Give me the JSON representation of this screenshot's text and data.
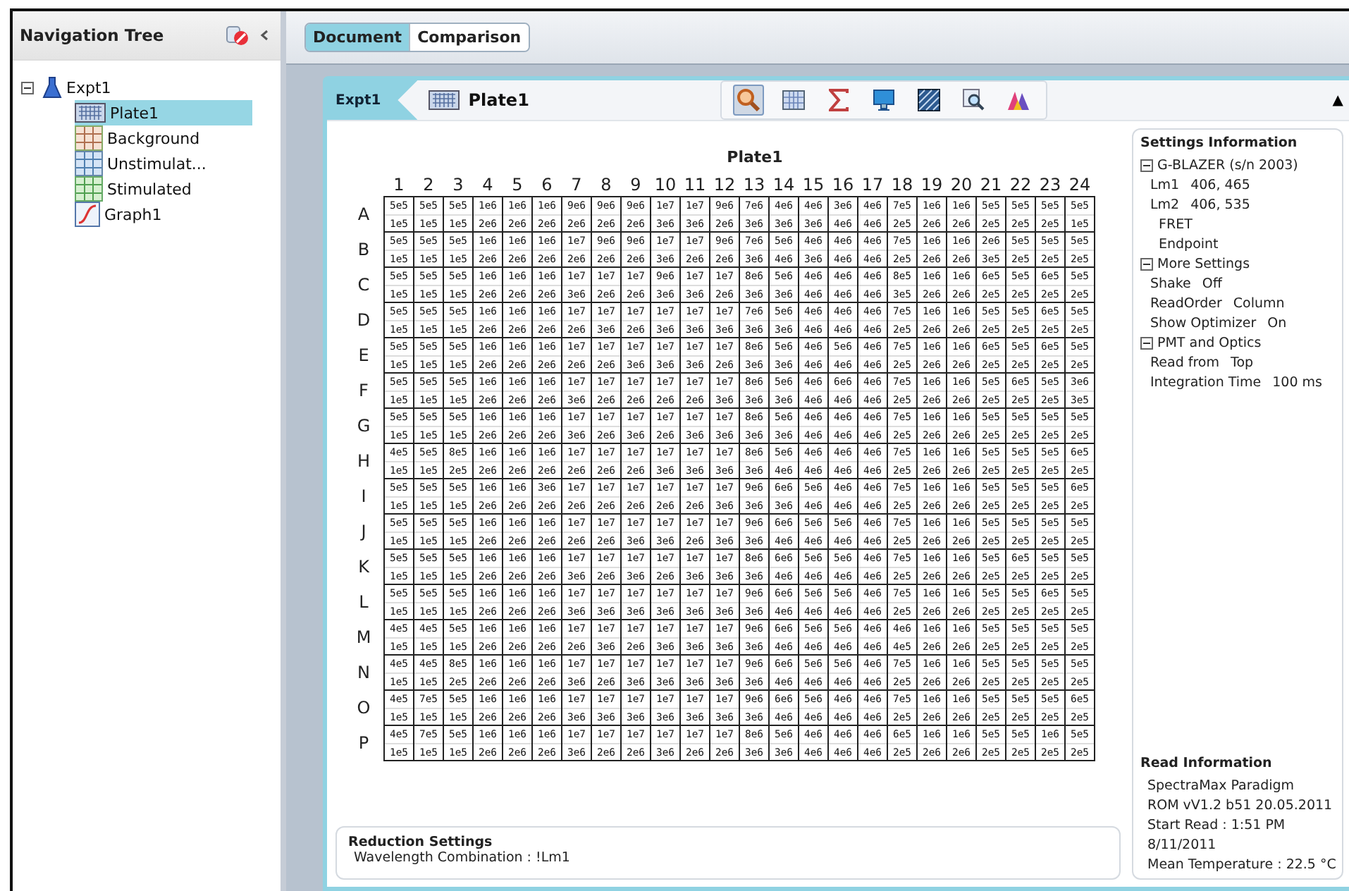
{
  "navigation": {
    "title": "Navigation Tree",
    "tree": [
      {
        "label": "Expt1",
        "kind": "experiment",
        "expanded": true,
        "selected": false,
        "children": [
          {
            "label": "Plate1",
            "kind": "plate",
            "selected": true
          },
          {
            "label": "Background",
            "kind": "background",
            "selected": false
          },
          {
            "label": "Unstimulat...",
            "kind": "unstimulated",
            "selected": false
          },
          {
            "label": "Stimulated",
            "kind": "stimulated",
            "selected": false
          },
          {
            "label": "Graph1",
            "kind": "graph",
            "selected": false
          }
        ]
      }
    ]
  },
  "tabs": [
    {
      "label": "Document",
      "selected": true
    },
    {
      "label": "Comparison",
      "selected": false
    }
  ],
  "document": {
    "breadcrumb": {
      "parent": "Expt1",
      "current": "Plate1"
    },
    "toolbar": [
      {
        "kind": "zoom",
        "selected": true
      },
      {
        "kind": "grid",
        "selected": false
      },
      {
        "kind": "sigma",
        "selected": false
      },
      {
        "kind": "monitor",
        "selected": false
      },
      {
        "kind": "pattern",
        "selected": false
      },
      {
        "kind": "search",
        "selected": false
      },
      {
        "kind": "peaks",
        "selected": false
      }
    ],
    "collapse_arrow": "▲",
    "plate": {
      "title": "Plate1",
      "columns": [
        "1",
        "2",
        "3",
        "4",
        "5",
        "6",
        "7",
        "8",
        "9",
        "10",
        "11",
        "12",
        "13",
        "14",
        "15",
        "16",
        "17",
        "18",
        "19",
        "20",
        "21",
        "22",
        "23",
        "24"
      ],
      "rows": [
        {
          "label": "A",
          "top": [
            "5e5",
            "5e5",
            "5e5",
            "1e6",
            "1e6",
            "1e6",
            "9e6",
            "9e6",
            "9e6",
            "1e7",
            "1e7",
            "9e6",
            "7e6",
            "4e6",
            "4e6",
            "3e6",
            "4e6",
            "7e5",
            "1e6",
            "1e6",
            "5e5",
            "5e5",
            "5e5",
            "5e5"
          ],
          "bottom": [
            "1e5",
            "1e5",
            "1e5",
            "2e6",
            "2e6",
            "2e6",
            "2e6",
            "2e6",
            "2e6",
            "3e6",
            "3e6",
            "2e6",
            "3e6",
            "3e6",
            "3e6",
            "4e6",
            "4e6",
            "2e5",
            "2e6",
            "2e6",
            "2e5",
            "2e5",
            "2e5",
            "1e5"
          ]
        },
        {
          "label": "B",
          "top": [
            "5e5",
            "5e5",
            "5e5",
            "1e6",
            "1e6",
            "1e6",
            "1e7",
            "9e6",
            "9e6",
            "1e7",
            "1e7",
            "9e6",
            "7e6",
            "5e6",
            "4e6",
            "4e6",
            "4e6",
            "7e5",
            "1e6",
            "1e6",
            "2e6",
            "5e5",
            "5e5",
            "5e5"
          ],
          "bottom": [
            "1e5",
            "1e5",
            "1e5",
            "2e6",
            "2e6",
            "2e6",
            "2e6",
            "2e6",
            "2e6",
            "3e6",
            "2e6",
            "2e6",
            "3e6",
            "4e6",
            "3e6",
            "4e6",
            "4e6",
            "2e5",
            "2e6",
            "2e6",
            "3e5",
            "2e5",
            "2e5",
            "2e5"
          ]
        },
        {
          "label": "C",
          "top": [
            "5e5",
            "5e5",
            "5e5",
            "1e6",
            "1e6",
            "1e6",
            "1e7",
            "1e7",
            "1e7",
            "9e6",
            "1e7",
            "1e7",
            "8e6",
            "5e6",
            "4e6",
            "4e6",
            "4e6",
            "8e5",
            "1e6",
            "1e6",
            "6e5",
            "5e5",
            "6e5",
            "5e5"
          ],
          "bottom": [
            "1e5",
            "1e5",
            "1e5",
            "2e6",
            "2e6",
            "2e6",
            "3e6",
            "2e6",
            "2e6",
            "3e6",
            "3e6",
            "2e6",
            "3e6",
            "3e6",
            "4e6",
            "4e6",
            "4e6",
            "3e5",
            "2e6",
            "2e6",
            "2e5",
            "2e5",
            "2e5",
            "2e5"
          ]
        },
        {
          "label": "D",
          "top": [
            "5e5",
            "5e5",
            "5e5",
            "1e6",
            "1e6",
            "1e6",
            "1e7",
            "1e7",
            "1e7",
            "1e7",
            "1e7",
            "1e7",
            "7e6",
            "5e6",
            "4e6",
            "4e6",
            "4e6",
            "7e5",
            "1e6",
            "1e6",
            "5e5",
            "5e5",
            "6e5",
            "5e5"
          ],
          "bottom": [
            "1e5",
            "1e5",
            "1e5",
            "2e6",
            "2e6",
            "2e6",
            "2e6",
            "3e6",
            "2e6",
            "3e6",
            "3e6",
            "3e6",
            "3e6",
            "3e6",
            "4e6",
            "4e6",
            "4e6",
            "2e5",
            "2e6",
            "2e6",
            "2e5",
            "2e5",
            "2e5",
            "2e5"
          ]
        },
        {
          "label": "E",
          "top": [
            "5e5",
            "5e5",
            "5e5",
            "1e6",
            "1e6",
            "1e6",
            "1e7",
            "1e7",
            "1e7",
            "1e7",
            "1e7",
            "1e7",
            "8e6",
            "5e6",
            "4e6",
            "5e6",
            "4e6",
            "7e5",
            "1e6",
            "1e6",
            "6e5",
            "5e5",
            "6e5",
            "5e5"
          ],
          "bottom": [
            "1e5",
            "1e5",
            "1e5",
            "2e6",
            "2e6",
            "2e6",
            "2e6",
            "2e6",
            "3e6",
            "3e6",
            "3e6",
            "2e6",
            "3e6",
            "3e6",
            "4e6",
            "4e6",
            "4e6",
            "2e5",
            "2e6",
            "2e6",
            "2e5",
            "2e5",
            "2e5",
            "2e5"
          ]
        },
        {
          "label": "F",
          "top": [
            "5e5",
            "5e5",
            "5e5",
            "1e6",
            "1e6",
            "1e6",
            "1e7",
            "1e7",
            "1e7",
            "1e7",
            "1e7",
            "1e7",
            "8e6",
            "5e6",
            "4e6",
            "6e6",
            "4e6",
            "7e5",
            "1e6",
            "1e6",
            "5e5",
            "6e5",
            "5e5",
            "3e6"
          ],
          "bottom": [
            "1e5",
            "1e5",
            "1e5",
            "2e6",
            "2e6",
            "2e6",
            "3e6",
            "2e6",
            "2e6",
            "2e6",
            "2e6",
            "3e6",
            "3e6",
            "3e6",
            "4e6",
            "4e6",
            "4e6",
            "2e5",
            "2e6",
            "2e6",
            "2e5",
            "2e5",
            "2e5",
            "3e5"
          ]
        },
        {
          "label": "G",
          "top": [
            "5e5",
            "5e5",
            "5e5",
            "1e6",
            "1e6",
            "1e6",
            "1e7",
            "1e7",
            "1e7",
            "1e7",
            "1e7",
            "1e7",
            "8e6",
            "5e6",
            "4e6",
            "4e6",
            "4e6",
            "7e5",
            "1e6",
            "1e6",
            "5e5",
            "5e5",
            "5e5",
            "5e5"
          ],
          "bottom": [
            "1e5",
            "1e5",
            "1e5",
            "2e6",
            "2e6",
            "2e6",
            "3e6",
            "2e6",
            "3e6",
            "2e6",
            "3e6",
            "3e6",
            "3e6",
            "3e6",
            "4e6",
            "4e6",
            "4e6",
            "2e5",
            "2e6",
            "2e6",
            "2e5",
            "2e5",
            "2e5",
            "2e5"
          ]
        },
        {
          "label": "H",
          "top": [
            "4e5",
            "5e5",
            "8e5",
            "1e6",
            "1e6",
            "1e6",
            "1e7",
            "1e7",
            "1e7",
            "1e7",
            "1e7",
            "1e7",
            "8e6",
            "5e6",
            "4e6",
            "4e6",
            "4e6",
            "7e5",
            "1e6",
            "1e6",
            "5e5",
            "5e5",
            "5e5",
            "6e5"
          ],
          "bottom": [
            "1e5",
            "1e5",
            "2e5",
            "2e6",
            "2e6",
            "2e6",
            "2e6",
            "2e6",
            "2e6",
            "3e6",
            "3e6",
            "3e6",
            "3e6",
            "4e6",
            "4e6",
            "4e6",
            "4e6",
            "2e5",
            "2e6",
            "2e6",
            "2e5",
            "2e5",
            "2e5",
            "2e5"
          ]
        },
        {
          "label": "I",
          "top": [
            "5e5",
            "5e5",
            "5e5",
            "1e6",
            "1e6",
            "3e6",
            "1e7",
            "1e7",
            "1e7",
            "1e7",
            "1e7",
            "1e7",
            "9e6",
            "6e6",
            "5e6",
            "4e6",
            "4e6",
            "7e5",
            "1e6",
            "1e6",
            "5e5",
            "5e5",
            "5e5",
            "6e5"
          ],
          "bottom": [
            "1e5",
            "1e5",
            "1e5",
            "2e6",
            "2e6",
            "2e6",
            "2e6",
            "2e6",
            "2e6",
            "2e6",
            "2e6",
            "3e6",
            "3e6",
            "3e6",
            "4e6",
            "4e6",
            "4e6",
            "2e5",
            "2e6",
            "2e6",
            "2e5",
            "2e5",
            "2e5",
            "2e5"
          ]
        },
        {
          "label": "J",
          "top": [
            "5e5",
            "5e5",
            "5e5",
            "1e6",
            "1e6",
            "1e6",
            "1e7",
            "1e7",
            "1e7",
            "1e7",
            "1e7",
            "1e7",
            "9e6",
            "6e6",
            "5e6",
            "5e6",
            "4e6",
            "7e5",
            "1e6",
            "1e6",
            "5e5",
            "5e5",
            "5e5",
            "5e5"
          ],
          "bottom": [
            "1e5",
            "1e5",
            "1e5",
            "2e6",
            "2e6",
            "2e6",
            "2e6",
            "2e6",
            "3e6",
            "3e6",
            "2e6",
            "3e6",
            "3e6",
            "4e6",
            "4e6",
            "4e6",
            "4e6",
            "2e5",
            "2e6",
            "2e6",
            "2e5",
            "2e5",
            "2e5",
            "2e5"
          ]
        },
        {
          "label": "K",
          "top": [
            "5e5",
            "5e5",
            "5e5",
            "1e6",
            "1e6",
            "1e6",
            "1e7",
            "1e7",
            "1e7",
            "1e7",
            "1e7",
            "1e7",
            "8e6",
            "6e6",
            "5e6",
            "5e6",
            "4e6",
            "7e5",
            "1e6",
            "1e6",
            "5e5",
            "6e5",
            "5e5",
            "5e5"
          ],
          "bottom": [
            "1e5",
            "1e5",
            "1e5",
            "2e6",
            "2e6",
            "2e6",
            "3e6",
            "2e6",
            "3e6",
            "2e6",
            "3e6",
            "3e6",
            "3e6",
            "4e6",
            "4e6",
            "4e6",
            "4e6",
            "2e5",
            "2e6",
            "2e6",
            "2e5",
            "2e5",
            "2e5",
            "2e5"
          ]
        },
        {
          "label": "L",
          "top": [
            "5e5",
            "5e5",
            "5e5",
            "1e6",
            "1e6",
            "1e6",
            "1e7",
            "1e7",
            "1e7",
            "1e7",
            "1e7",
            "1e7",
            "9e6",
            "6e6",
            "5e6",
            "5e6",
            "4e6",
            "7e5",
            "1e6",
            "1e6",
            "5e5",
            "5e5",
            "6e5",
            "5e5"
          ],
          "bottom": [
            "1e5",
            "1e5",
            "1e5",
            "2e6",
            "2e6",
            "2e6",
            "3e6",
            "3e6",
            "3e6",
            "3e6",
            "3e6",
            "3e6",
            "3e6",
            "4e6",
            "4e6",
            "4e6",
            "4e6",
            "2e5",
            "2e6",
            "2e6",
            "2e5",
            "2e5",
            "2e5",
            "2e5"
          ]
        },
        {
          "label": "M",
          "top": [
            "4e5",
            "4e5",
            "5e5",
            "1e6",
            "1e6",
            "1e6",
            "1e7",
            "1e7",
            "1e7",
            "1e7",
            "1e7",
            "1e7",
            "9e6",
            "6e6",
            "5e6",
            "5e6",
            "4e6",
            "4e6",
            "1e6",
            "1e6",
            "5e5",
            "5e5",
            "5e5",
            "5e5"
          ],
          "bottom": [
            "1e5",
            "1e5",
            "1e5",
            "2e6",
            "2e6",
            "2e6",
            "2e6",
            "3e6",
            "2e6",
            "3e6",
            "3e6",
            "3e6",
            "3e6",
            "4e6",
            "4e6",
            "4e6",
            "4e6",
            "4e5",
            "2e6",
            "2e6",
            "2e5",
            "2e5",
            "2e5",
            "2e5"
          ]
        },
        {
          "label": "N",
          "top": [
            "4e5",
            "4e5",
            "8e5",
            "1e6",
            "1e6",
            "1e6",
            "1e7",
            "1e7",
            "1e7",
            "1e7",
            "1e7",
            "1e7",
            "9e6",
            "6e6",
            "5e6",
            "5e6",
            "4e6",
            "7e5",
            "1e6",
            "1e6",
            "5e5",
            "5e5",
            "5e5",
            "5e5"
          ],
          "bottom": [
            "1e5",
            "1e5",
            "2e5",
            "2e6",
            "2e6",
            "2e6",
            "3e6",
            "2e6",
            "3e6",
            "3e6",
            "3e6",
            "3e6",
            "3e6",
            "4e6",
            "4e6",
            "4e6",
            "4e6",
            "2e5",
            "2e6",
            "2e6",
            "2e5",
            "2e5",
            "2e5",
            "2e5"
          ]
        },
        {
          "label": "O",
          "top": [
            "4e5",
            "7e5",
            "5e5",
            "1e6",
            "1e6",
            "1e6",
            "1e7",
            "1e7",
            "1e7",
            "1e7",
            "1e7",
            "1e7",
            "9e6",
            "6e6",
            "5e6",
            "4e6",
            "4e6",
            "7e5",
            "1e6",
            "1e6",
            "5e5",
            "5e5",
            "5e5",
            "6e5"
          ],
          "bottom": [
            "1e5",
            "1e5",
            "1e5",
            "2e6",
            "2e6",
            "2e6",
            "3e6",
            "3e6",
            "3e6",
            "3e6",
            "3e6",
            "3e6",
            "3e6",
            "4e6",
            "4e6",
            "4e6",
            "4e6",
            "2e5",
            "2e6",
            "2e6",
            "2e5",
            "2e5",
            "2e5",
            "2e5"
          ]
        },
        {
          "label": "P",
          "top": [
            "4e5",
            "7e5",
            "5e5",
            "1e6",
            "1e6",
            "1e6",
            "1e7",
            "1e7",
            "1e7",
            "1e7",
            "1e7",
            "1e7",
            "8e6",
            "5e6",
            "4e6",
            "4e6",
            "4e6",
            "6e5",
            "1e6",
            "1e6",
            "5e5",
            "5e5",
            "1e6",
            "5e5"
          ],
          "bottom": [
            "1e5",
            "1e5",
            "1e5",
            "2e6",
            "2e6",
            "2e6",
            "3e6",
            "2e6",
            "2e6",
            "3e6",
            "2e6",
            "2e6",
            "3e6",
            "3e6",
            "4e6",
            "4e6",
            "4e6",
            "2e5",
            "2e6",
            "2e6",
            "2e5",
            "2e5",
            "2e5",
            "2e5"
          ]
        }
      ]
    },
    "reduction": {
      "title": "Reduction Settings",
      "text": "Wavelength Combination : !Lm1"
    },
    "settings": {
      "title": "Settings Information",
      "groups": [
        {
          "label": "G-BLAZER (s/n 2003)",
          "expanded": true,
          "items": [
            {
              "kind": "pair",
              "name": "Lm1",
              "value": "406, 465"
            },
            {
              "kind": "pair",
              "name": "Lm2",
              "value": "406, 535"
            },
            {
              "kind": "note",
              "text": "FRET"
            },
            {
              "kind": "note",
              "text": "Endpoint"
            }
          ]
        },
        {
          "label": "More Settings",
          "expanded": true,
          "items": [
            {
              "kind": "pair",
              "name": "Shake",
              "value": "Off"
            },
            {
              "kind": "pair",
              "name": "ReadOrder",
              "value": "Column"
            },
            {
              "kind": "pair",
              "name": "Show Optimizer",
              "value": "On"
            }
          ]
        },
        {
          "label": "PMT and Optics",
          "expanded": true,
          "items": [
            {
              "kind": "pair",
              "name": "Read from",
              "value": "Top"
            },
            {
              "kind": "pair",
              "name": "Integration Time",
              "value": "100 ms"
            }
          ]
        }
      ]
    },
    "read_info": {
      "title": "Read Information",
      "lines": [
        "SpectraMax Paradigm",
        "ROM vV1.2 b51 20.05.2011",
        "Start Read : 1:51 PM",
        "8/11/2011",
        "Mean Temperature : 22.5 °C"
      ]
    }
  }
}
